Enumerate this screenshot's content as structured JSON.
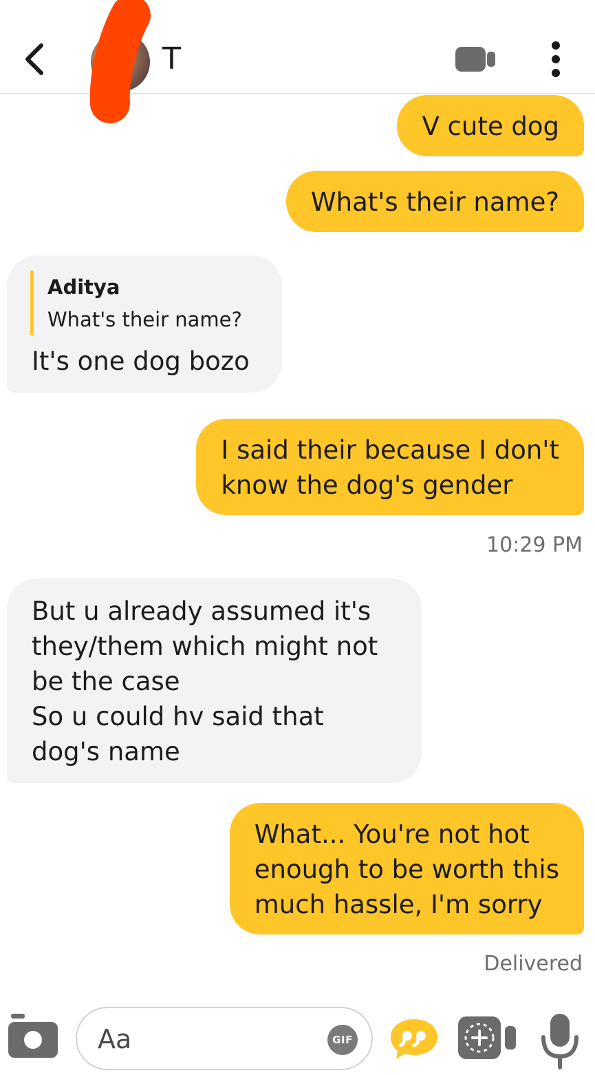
{
  "header": {
    "back_icon": "chevron-left-icon",
    "contact_name": "T",
    "video_icon": "video-camera-icon",
    "more_icon": "vertical-dots-icon"
  },
  "messages": [
    {
      "direction": "outgoing",
      "text": "V cute dog"
    },
    {
      "direction": "outgoing",
      "text": "What's their name?"
    },
    {
      "direction": "incoming",
      "reply_to": {
        "author": "Aditya",
        "text": "What's their name?"
      },
      "text": "It's one dog bozo"
    },
    {
      "direction": "outgoing",
      "text": "I said their because I don't\nknow the dog's gender"
    },
    {
      "direction": "incoming",
      "text": "But u already assumed it's\nthey/them which might not\nbe the case\nSo u could hv said that\ndog's name"
    },
    {
      "direction": "outgoing",
      "text": "What... You're not hot\nenough to be worth this\nmuch hassle, I'm sorry"
    }
  ],
  "timestamp": "10:29 PM",
  "delivery_status": "Delivered",
  "composer": {
    "placeholder": "Aa",
    "gif_label": "GIF",
    "icons": [
      "camera-icon",
      "quote-icon",
      "video-message-icon",
      "microphone-icon"
    ]
  },
  "colors": {
    "outgoing_bubble": "#ffc629",
    "incoming_bubble": "#f3f3f3",
    "accent": "#ffc629",
    "redaction": "#ff4500"
  }
}
